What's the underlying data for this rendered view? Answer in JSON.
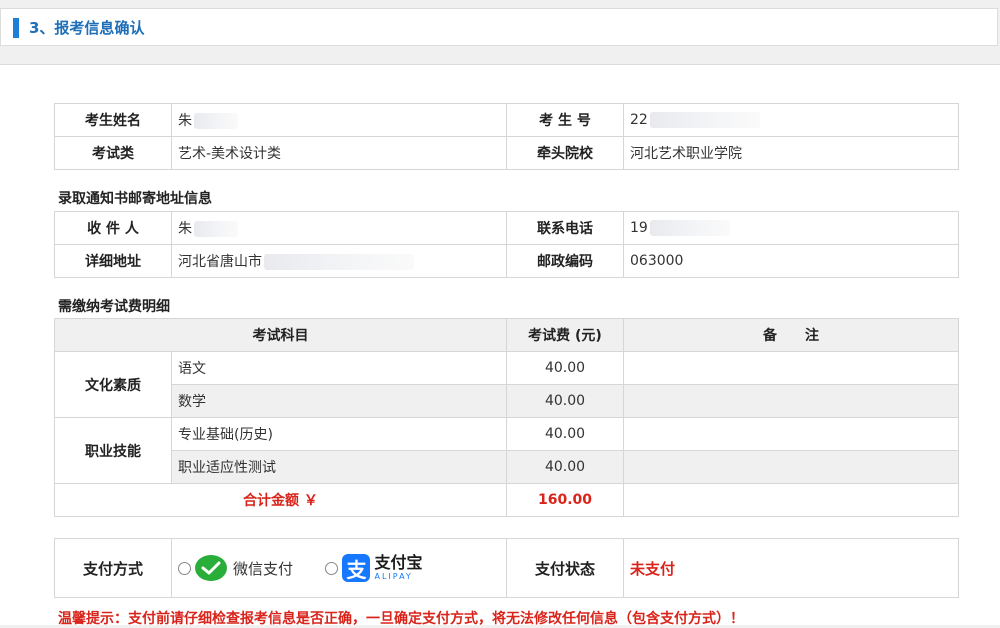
{
  "section": {
    "title": "3、报考信息确认"
  },
  "candidate": {
    "name_label": "考生姓名",
    "name_value": "朱",
    "id_label": "考 生 号",
    "id_value": "22",
    "category_label": "考试类",
    "category_value": "艺术-美术设计类",
    "school_label": "牵头院校",
    "school_value": "河北艺术职业学院"
  },
  "mailing": {
    "title": "录取通知书邮寄地址信息",
    "recipient_label": "收 件 人",
    "recipient_value": "朱",
    "phone_label": "联系电话",
    "phone_value": "19",
    "address_label": "详细地址",
    "address_value": "河北省唐山市",
    "postcode_label": "邮政编码",
    "postcode_value": "063000"
  },
  "fees": {
    "title": "需缴纳考试费明细",
    "headers": {
      "subject": "考试科目",
      "fee": "考试费 (元)",
      "remark": "备　　注"
    },
    "groups": [
      {
        "name": "文化素质",
        "items": [
          {
            "subject": "语文",
            "fee": "40.00"
          },
          {
            "subject": "数学",
            "fee": "40.00"
          }
        ]
      },
      {
        "name": "职业技能",
        "items": [
          {
            "subject": "专业基础(历史)",
            "fee": "40.00"
          },
          {
            "subject": "职业适应性测试",
            "fee": "40.00"
          }
        ]
      }
    ],
    "total_label": "合计金额 ￥",
    "total_value": "160.00"
  },
  "payment": {
    "method_label": "支付方式",
    "wechat_label": "微信支付",
    "alipay_cn": "支付宝",
    "alipay_en": "ALIPAY",
    "alipay_mark": "支",
    "status_label": "支付状态",
    "status_value": "未支付"
  },
  "notice": "温馨提示：支付前请仔细检查报考信息是否正确，一旦确定支付方式，将无法修改任何信息（包含支付方式）！",
  "colors": {
    "accent": "#1e7fd8",
    "alert": "#d9241b",
    "wechat": "#2aae3a",
    "alipay": "#1677ff"
  }
}
